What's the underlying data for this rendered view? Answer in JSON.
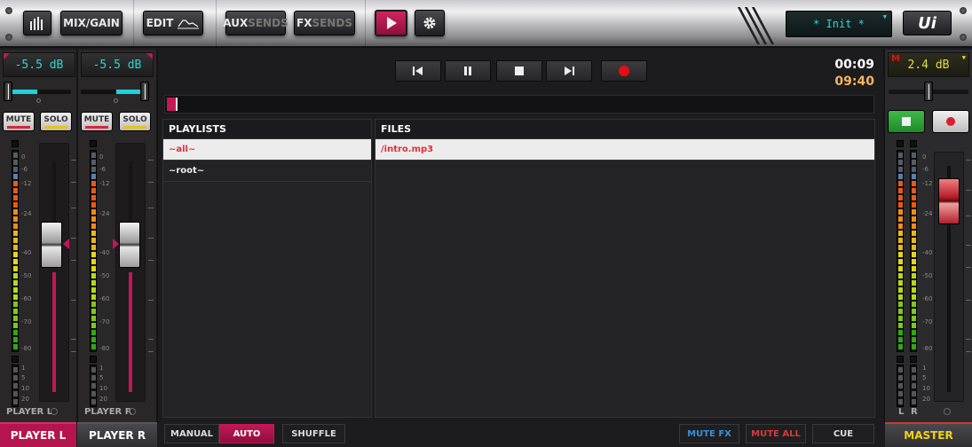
{
  "topbar": {
    "meters_icon": "bar-meters-icon",
    "mix_gain": "MIX/GAIN",
    "edit": "EDIT",
    "aux_a": "AUX",
    "aux_b": "SENDS",
    "fx_a": "FX",
    "fx_b": "SENDS",
    "play_icon": "play-icon",
    "settings_icon": "gear-icon",
    "preset": "* Init *",
    "logo": "Ui"
  },
  "channels": [
    {
      "name": "PLAYER L",
      "level": "-5.5 dB",
      "mute": "MUTE",
      "solo": "SOLO",
      "pan": 0.25,
      "tab": "PLAYER L",
      "active": true
    },
    {
      "name": "PLAYER R",
      "level": "-5.5 dB",
      "mute": "MUTE",
      "solo": "SOLO",
      "pan": 0.75,
      "tab": "PLAYER R",
      "active": false
    }
  ],
  "meter_scale": [
    "0",
    "-6",
    "-12",
    "-24",
    "-40",
    "-50",
    "-60",
    "-70",
    "-80"
  ],
  "gr_scale": [
    "1",
    "5",
    "10",
    "20"
  ],
  "master": {
    "level": "2.4 dB",
    "m_flag": "M",
    "tab": "MASTER",
    "l": "L",
    "r": "R"
  },
  "transport": {
    "prev": "skip-previous-icon",
    "pause": "pause-icon",
    "stop": "stop-icon",
    "next": "skip-next-icon",
    "record": "record-icon",
    "elapsed": "00:09",
    "remaining": "09:40",
    "progress": 0.015
  },
  "playlists": {
    "header": "PLAYLISTS",
    "items": [
      "~all~",
      "~root~"
    ],
    "selected": 0
  },
  "files": {
    "header": "FILES",
    "items": [
      "/intro.mp3"
    ],
    "selected": 0
  },
  "modes": {
    "manual": "MANUAL",
    "auto": "AUTO",
    "shuffle": "SHUFFLE"
  },
  "actions": {
    "mute_fx": "MUTE FX",
    "mute_all": "MUTE ALL",
    "cue": "CUE"
  },
  "colors": {
    "accent": "#c21856",
    "cyan": "#2fd6d0",
    "master_yellow": "#f0d21c",
    "mute_fx": "#3b8fd6",
    "mute_all": "#d63a3a"
  }
}
